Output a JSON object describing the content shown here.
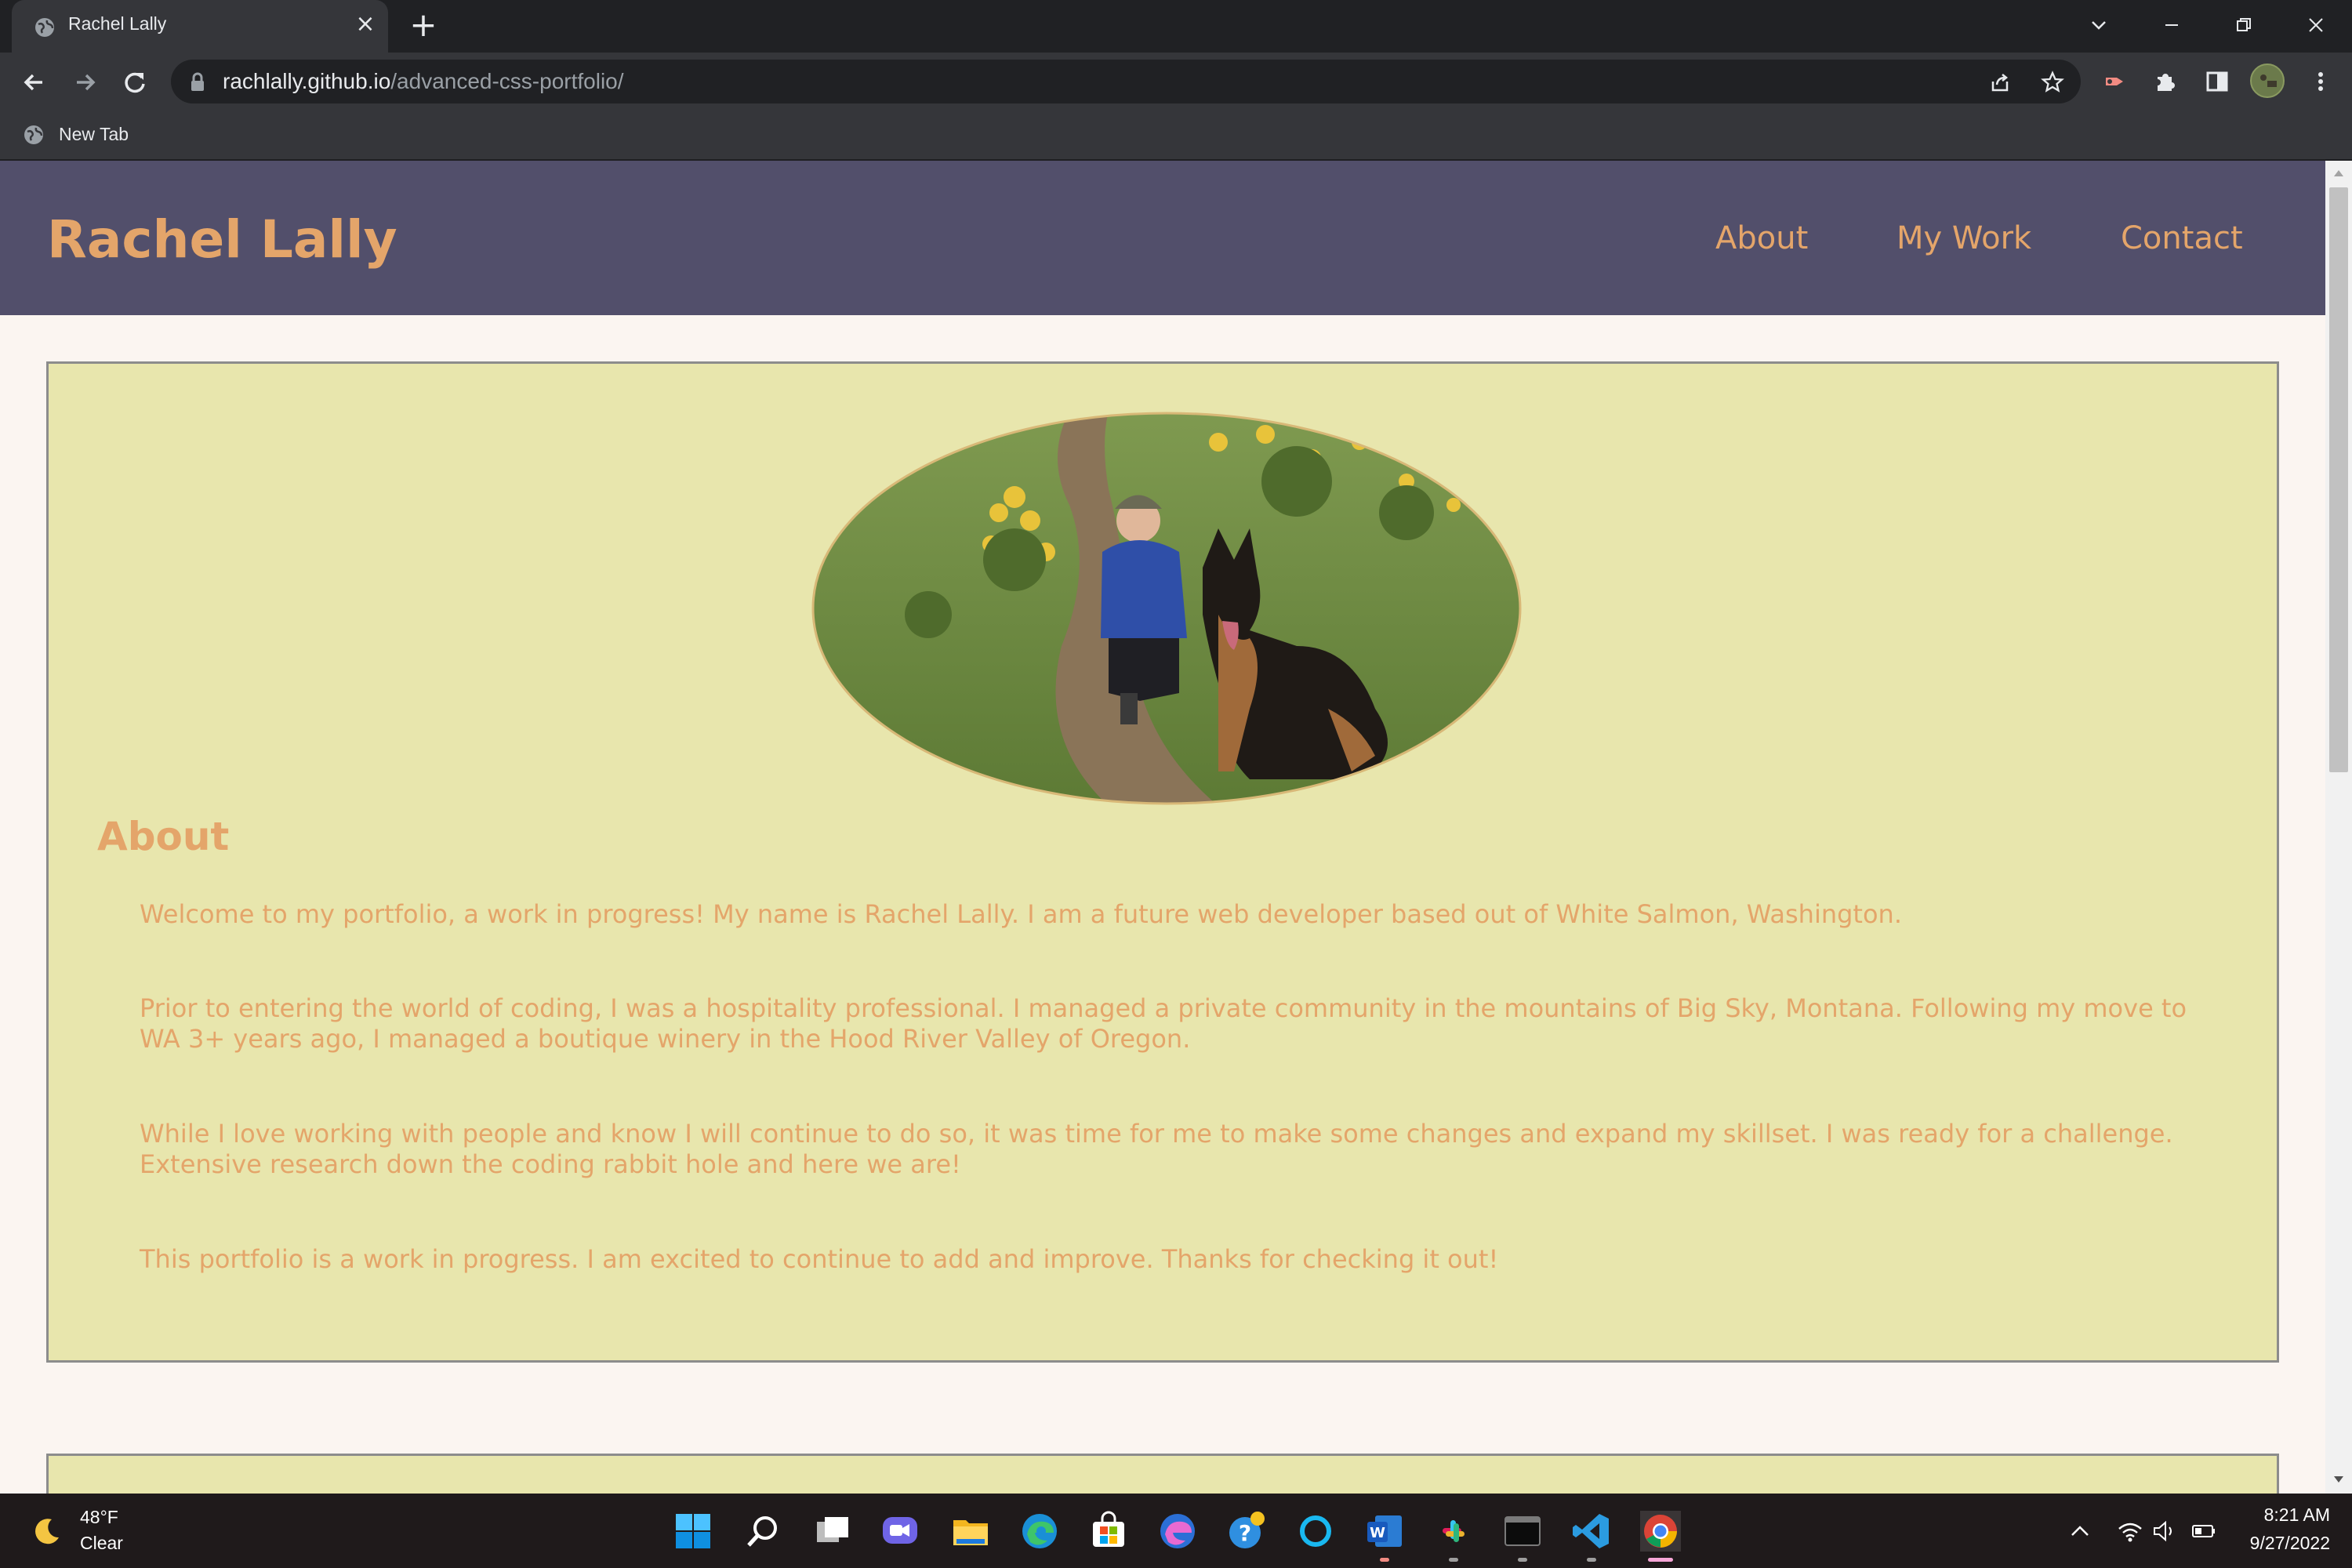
{
  "browser": {
    "tab_title": "Rachel Lally",
    "url_host": "rachlally.github.io",
    "url_path": "/advanced-css-portfolio/",
    "bookmark_label": "New Tab"
  },
  "site": {
    "brand": "Rachel Lally",
    "nav": [
      {
        "label": "About"
      },
      {
        "label": "My Work"
      },
      {
        "label": "Contact"
      }
    ]
  },
  "about": {
    "heading": "About",
    "paragraphs": [
      "Welcome to my portfolio, a work in progress! My name is Rachel Lally. I am a future web developer based out of White Salmon, Washington.",
      "Prior to entering the world of coding, I was a hospitality professional. I managed a private community in the mountains of Big Sky, Montana. Following my move to WA 3+ years ago, I managed a boutique winery in the Hood River Valley of Oregon.",
      "While I love working with people and know I will continue to do so, it was time for me to make some changes and expand my skillset. I was ready for a challenge. Extensive research down the coding rabbit hole and here we are!",
      "This portfolio is a work in progress. I am excited to continue to add and improve. Thanks for checking it out!"
    ]
  },
  "taskbar": {
    "weather_temp": "48°F",
    "weather_condition": "Clear",
    "time": "8:21 AM",
    "date": "9/27/2022",
    "apps": [
      "start-icon",
      "search-icon",
      "task-view-icon",
      "chat-icon",
      "file-explorer-icon",
      "edge-icon",
      "store-icon",
      "edge-canary-icon",
      "help-icon",
      "cortana-icon",
      "word-icon",
      "slack-icon",
      "terminal-icon",
      "vscode-icon",
      "chrome-icon"
    ]
  },
  "colors": {
    "header_bg": "#524f6b",
    "accent": "#e4a56a",
    "card_bg": "#e8e6ad",
    "page_bg": "#fbf5f1"
  }
}
